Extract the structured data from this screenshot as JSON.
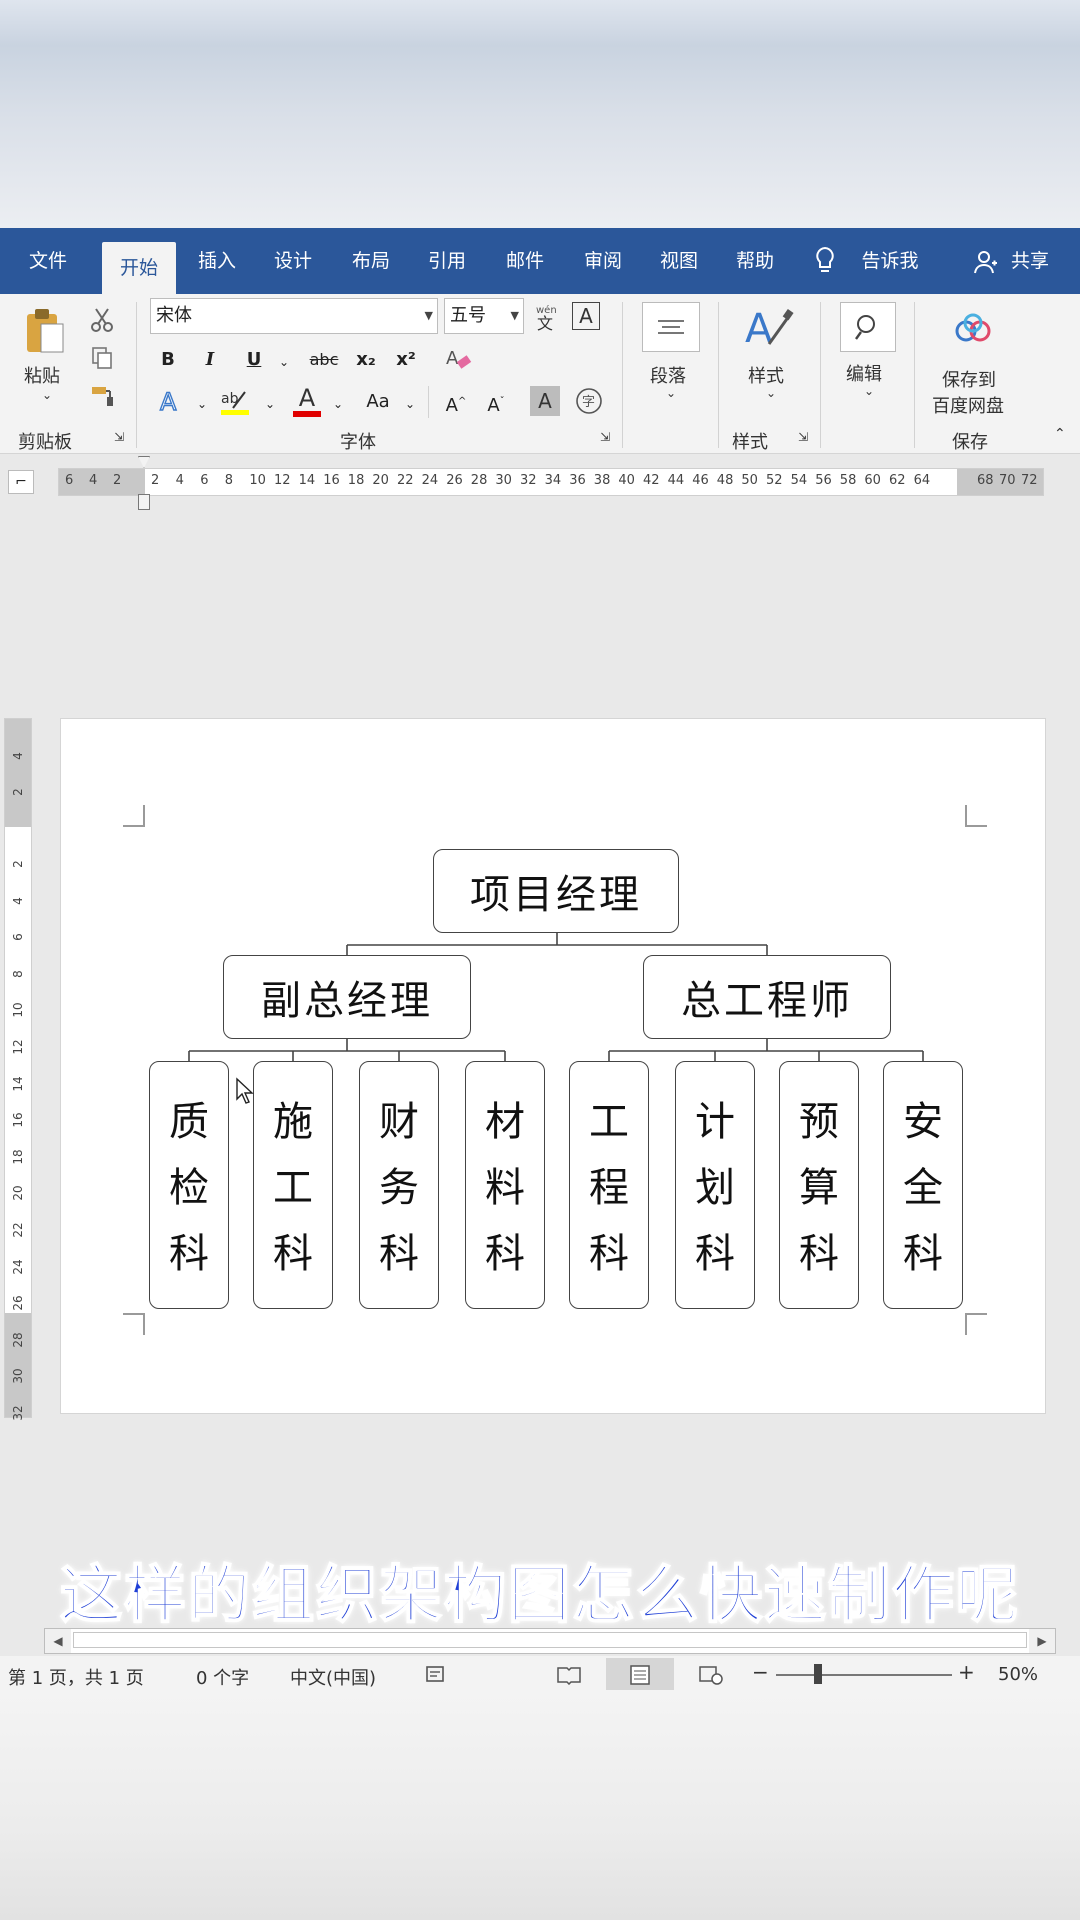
{
  "tabs": [
    "文件",
    "开始",
    "插入",
    "设计",
    "布局",
    "引用",
    "邮件",
    "审阅",
    "视图",
    "帮助"
  ],
  "tell_me": "告诉我",
  "share": "共享",
  "clipboard": {
    "paste": "粘贴",
    "group": "剪贴板"
  },
  "font": {
    "name": "宋体",
    "size": "五号",
    "group": "字体",
    "bold": "B",
    "italic": "I",
    "underline": "U",
    "strike": "abc",
    "subscript": "x₂",
    "superscript": "x²",
    "text_color": "A",
    "case": "Aa",
    "grow": "A",
    "shrink": "A",
    "border_char": "A"
  },
  "paragraph": {
    "label": "段落"
  },
  "styles": {
    "label": "样式",
    "group": "样式"
  },
  "editing": {
    "label": "编辑"
  },
  "save": {
    "label": "保存到百度网盘",
    "line1": "保存到",
    "line2": "百度网盘",
    "group": "保存"
  },
  "ruler_h": [
    "6",
    "4",
    "2",
    "2",
    "4",
    "6",
    "8",
    "10",
    "12",
    "14",
    "16",
    "18",
    "20",
    "22",
    "24",
    "26",
    "28",
    "30",
    "32",
    "34",
    "36",
    "38",
    "40",
    "42",
    "44",
    "46",
    "48",
    "50",
    "52",
    "54",
    "56",
    "58",
    "60",
    "62",
    "64",
    "68",
    "70",
    "72"
  ],
  "ruler_v": [
    "4",
    "2",
    "2",
    "4",
    "6",
    "8",
    "10",
    "12",
    "14",
    "16",
    "18",
    "20",
    "22",
    "24",
    "26",
    "28",
    "30",
    "32"
  ],
  "org_chart": {
    "root": "项目经理",
    "level2": [
      "副总经理",
      "总工程师"
    ],
    "level3": [
      "质检科",
      "施工科",
      "财务科",
      "材料科",
      "工程科",
      "计划科",
      "预算科",
      "安全科"
    ]
  },
  "caption": "这样的组织架构图怎么快速制作呢",
  "status": {
    "page": "第 1 页，共 1 页",
    "words": "0 个字",
    "lang": "中文(中国)",
    "zoom": "50%"
  },
  "zoom_minus": "−",
  "zoom_plus": "+",
  "colors": {
    "ribbon_blue": "#2b579a",
    "caption_blue": "#1f3fd6",
    "font_red": "#e00000"
  }
}
